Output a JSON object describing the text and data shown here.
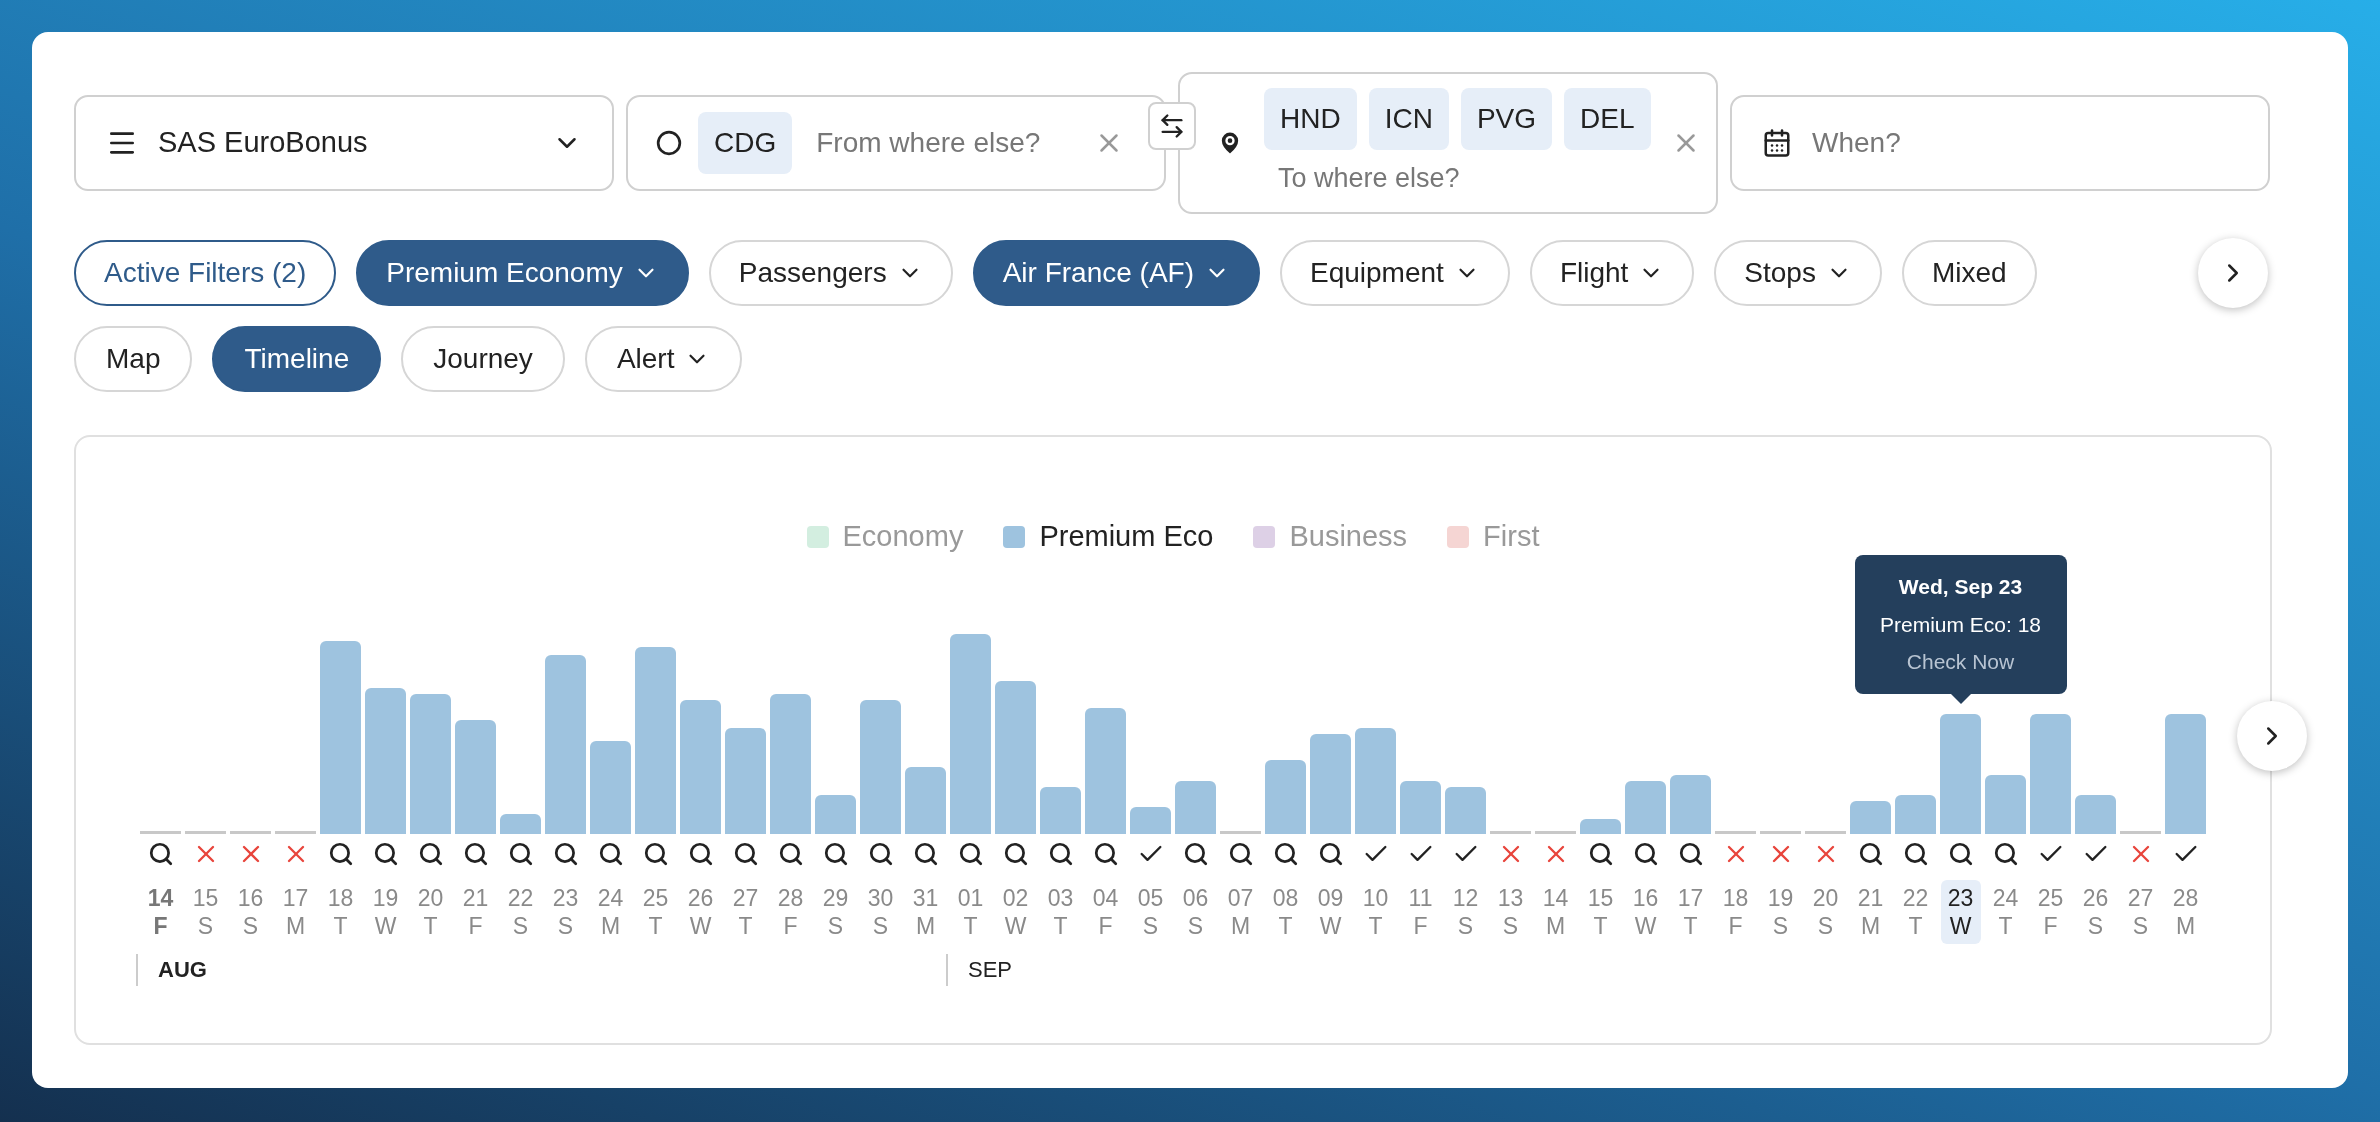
{
  "program_select": {
    "label": "SAS EuroBonus"
  },
  "origin": {
    "tags": [
      "CDG"
    ],
    "placeholder": "From where else?"
  },
  "destination": {
    "tags": [
      "HND",
      "ICN",
      "PVG",
      "DEL"
    ],
    "placeholder": "To where else?"
  },
  "date": {
    "placeholder": "When?"
  },
  "filters": [
    {
      "kind": "summary",
      "label": "Active Filters (2)",
      "selected": false,
      "dropdown": false
    },
    {
      "kind": "filter",
      "label": "Premium Economy",
      "selected": true,
      "dropdown": true
    },
    {
      "kind": "filter",
      "label": "Passengers",
      "selected": false,
      "dropdown": true
    },
    {
      "kind": "filter",
      "label": "Air France (AF)",
      "selected": true,
      "dropdown": true
    },
    {
      "kind": "filter",
      "label": "Equipment",
      "selected": false,
      "dropdown": true
    },
    {
      "kind": "filter",
      "label": "Flight",
      "selected": false,
      "dropdown": true
    },
    {
      "kind": "filter",
      "label": "Stops",
      "selected": false,
      "dropdown": true
    },
    {
      "kind": "filter",
      "label": "Mixed",
      "selected": false,
      "dropdown": false
    }
  ],
  "views": [
    {
      "label": "Map",
      "selected": false,
      "dropdown": false
    },
    {
      "label": "Timeline",
      "selected": true,
      "dropdown": false
    },
    {
      "label": "Journey",
      "selected": false,
      "dropdown": false
    },
    {
      "label": "Alert",
      "selected": false,
      "dropdown": true
    }
  ],
  "chart": {
    "legend": [
      {
        "label": "Economy",
        "color": "#d3eee0",
        "selected": false
      },
      {
        "label": "Premium Eco",
        "color": "#9ec3df",
        "selected": true
      },
      {
        "label": "Business",
        "color": "#ddd0e6",
        "selected": false
      },
      {
        "label": "First",
        "color": "#f5d5d3",
        "selected": false
      }
    ],
    "tooltip": {
      "title": "Wed, Sep 23",
      "line": "Premium Eco: 18",
      "link": "Check Now"
    },
    "days": [
      {
        "day": "14",
        "weekday": "F",
        "kind": "search",
        "selected": false,
        "today": true,
        "month": {
          "label": "AUG",
          "current": true
        }
      },
      {
        "day": "15",
        "weekday": "S",
        "kind": "none",
        "selected": false,
        "today": false
      },
      {
        "day": "16",
        "weekday": "S",
        "kind": "none",
        "selected": false,
        "today": false
      },
      {
        "day": "17",
        "weekday": "M",
        "kind": "none",
        "selected": false,
        "today": false
      },
      {
        "day": "18",
        "weekday": "T",
        "kind": "search",
        "selected": false,
        "today": false
      },
      {
        "day": "19",
        "weekday": "W",
        "kind": "search",
        "selected": false,
        "today": false
      },
      {
        "day": "20",
        "weekday": "T",
        "kind": "search",
        "selected": false,
        "today": false
      },
      {
        "day": "21",
        "weekday": "F",
        "kind": "search",
        "selected": false,
        "today": false
      },
      {
        "day": "22",
        "weekday": "S",
        "kind": "search",
        "selected": false,
        "today": false
      },
      {
        "day": "23",
        "weekday": "S",
        "kind": "search",
        "selected": false,
        "today": false
      },
      {
        "day": "24",
        "weekday": "M",
        "kind": "search",
        "selected": false,
        "today": false
      },
      {
        "day": "25",
        "weekday": "T",
        "kind": "search",
        "selected": false,
        "today": false
      },
      {
        "day": "26",
        "weekday": "W",
        "kind": "search",
        "selected": false,
        "today": false
      },
      {
        "day": "27",
        "weekday": "T",
        "kind": "search",
        "selected": false,
        "today": false
      },
      {
        "day": "28",
        "weekday": "F",
        "kind": "search",
        "selected": false,
        "today": false
      },
      {
        "day": "29",
        "weekday": "S",
        "kind": "search",
        "selected": false,
        "today": false
      },
      {
        "day": "30",
        "weekday": "S",
        "kind": "search",
        "selected": false,
        "today": false
      },
      {
        "day": "31",
        "weekday": "M",
        "kind": "search",
        "selected": false,
        "today": false
      },
      {
        "day": "01",
        "weekday": "T",
        "kind": "search",
        "selected": false,
        "today": false,
        "month": {
          "label": "SEP",
          "current": false
        }
      },
      {
        "day": "02",
        "weekday": "W",
        "kind": "search",
        "selected": false,
        "today": false
      },
      {
        "day": "03",
        "weekday": "T",
        "kind": "search",
        "selected": false,
        "today": false
      },
      {
        "day": "04",
        "weekday": "F",
        "kind": "search",
        "selected": false,
        "today": false
      },
      {
        "day": "05",
        "weekday": "S",
        "kind": "available",
        "selected": false,
        "today": false
      },
      {
        "day": "06",
        "weekday": "S",
        "kind": "search",
        "selected": false,
        "today": false
      },
      {
        "day": "07",
        "weekday": "M",
        "kind": "search",
        "selected": false,
        "today": false
      },
      {
        "day": "08",
        "weekday": "T",
        "kind": "search",
        "selected": false,
        "today": false
      },
      {
        "day": "09",
        "weekday": "W",
        "kind": "search",
        "selected": false,
        "today": false
      },
      {
        "day": "10",
        "weekday": "T",
        "kind": "available",
        "selected": false,
        "today": false
      },
      {
        "day": "11",
        "weekday": "F",
        "kind": "available",
        "selected": false,
        "today": false
      },
      {
        "day": "12",
        "weekday": "S",
        "kind": "available",
        "selected": false,
        "today": false
      },
      {
        "day": "13",
        "weekday": "S",
        "kind": "none",
        "selected": false,
        "today": false
      },
      {
        "day": "14",
        "weekday": "M",
        "kind": "none",
        "selected": false,
        "today": false
      },
      {
        "day": "15",
        "weekday": "T",
        "kind": "search",
        "selected": false,
        "today": false
      },
      {
        "day": "16",
        "weekday": "W",
        "kind": "search",
        "selected": false,
        "today": false
      },
      {
        "day": "17",
        "weekday": "T",
        "kind": "search",
        "selected": false,
        "today": false
      },
      {
        "day": "18",
        "weekday": "F",
        "kind": "none",
        "selected": false,
        "today": false
      },
      {
        "day": "19",
        "weekday": "S",
        "kind": "none",
        "selected": false,
        "today": false
      },
      {
        "day": "20",
        "weekday": "S",
        "kind": "none",
        "selected": false,
        "today": false
      },
      {
        "day": "21",
        "weekday": "M",
        "kind": "search",
        "selected": false,
        "today": false
      },
      {
        "day": "22",
        "weekday": "T",
        "kind": "search",
        "selected": false,
        "today": false
      },
      {
        "day": "23",
        "weekday": "W",
        "kind": "search",
        "selected": true,
        "today": false
      },
      {
        "day": "24",
        "weekday": "T",
        "kind": "search",
        "selected": false,
        "today": false
      },
      {
        "day": "25",
        "weekday": "F",
        "kind": "available",
        "selected": false,
        "today": false
      },
      {
        "day": "26",
        "weekday": "S",
        "kind": "available",
        "selected": false,
        "today": false
      },
      {
        "day": "27",
        "weekday": "S",
        "kind": "none",
        "selected": false,
        "today": false
      },
      {
        "day": "28",
        "weekday": "M",
        "kind": "available",
        "selected": false,
        "today": false
      }
    ]
  }
}
